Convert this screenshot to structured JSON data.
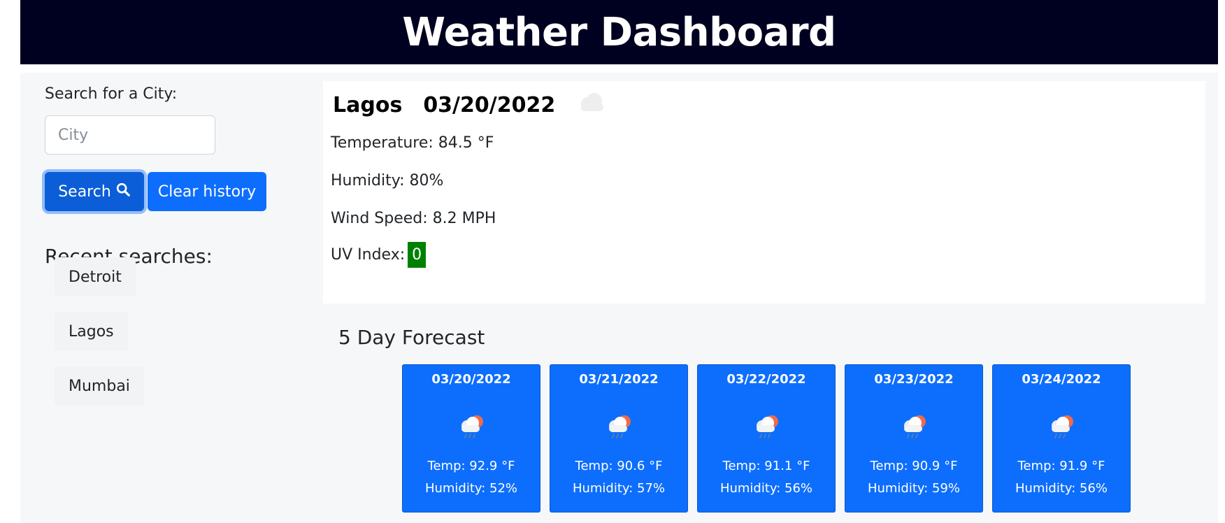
{
  "header": {
    "title": "Weather Dashboard"
  },
  "sidebar": {
    "search_label": "Search for a City:",
    "city_placeholder": "City",
    "city_value": "",
    "search_button": "Search",
    "clear_button": "Clear history",
    "recent_title": "Recent searches:",
    "recent": [
      "Detroit",
      "Lagos",
      "Mumbai"
    ]
  },
  "current": {
    "city": "Lagos",
    "date": "03/20/2022",
    "icon": "cloud-icon",
    "temperature": "Temperature: 84.5 °F",
    "humidity": "Humidity: 80%",
    "wind": "Wind Speed: 8.2 MPH",
    "uv_label": "UV Index:",
    "uv_value": "0",
    "uv_color": "#008000"
  },
  "forecast": {
    "title": "5 Day Forecast",
    "days": [
      {
        "date": "03/20/2022",
        "icon": "rain-sun-cloud-icon",
        "temp": "Temp: 92.9 °F",
        "humidity": "Humidity: 52%"
      },
      {
        "date": "03/21/2022",
        "icon": "rain-sun-cloud-icon",
        "temp": "Temp: 90.6 °F",
        "humidity": "Humidity: 57%"
      },
      {
        "date": "03/22/2022",
        "icon": "rain-sun-cloud-icon",
        "temp": "Temp: 91.1 °F",
        "humidity": "Humidity: 56%"
      },
      {
        "date": "03/23/2022",
        "icon": "rain-sun-cloud-icon",
        "temp": "Temp: 90.9 °F",
        "humidity": "Humidity: 59%"
      },
      {
        "date": "03/24/2022",
        "icon": "rain-sun-cloud-icon",
        "temp": "Temp: 91.9 °F",
        "humidity": "Humidity: 56%"
      }
    ]
  },
  "colors": {
    "header_bg": "#000020",
    "accent": "#0d6efd",
    "page_bg": "#f6f7f8"
  }
}
